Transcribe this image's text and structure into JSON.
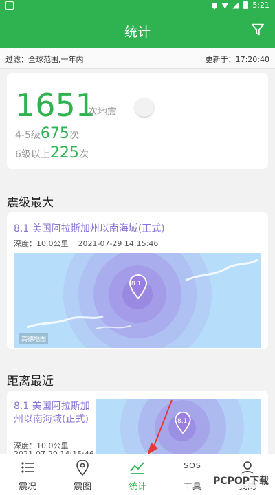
{
  "app": {
    "title": "统计",
    "time": "5:21"
  },
  "filter": {
    "left": "过滤：全球范围,一年内",
    "right": "更新于：17:20:40"
  },
  "stats": {
    "total": "1651",
    "total_unit": "次地震",
    "mag45_prefix": "4-5级",
    "mag45_count": "675",
    "mag45_suffix": "次",
    "mag6_prefix": "6级以上",
    "mag6_count": "225",
    "mag6_suffix": "次"
  },
  "section_max": {
    "title": "震级最大",
    "quake_title": "8.1   美国阿拉斯加州以南海域(正式)",
    "depth": "深度：10.0公里",
    "time": "2021-07-29 14:15:46",
    "marker": "8.1",
    "map_brand": "高德地图"
  },
  "section_near": {
    "title": "距离最近",
    "quake_title": "8.1   美国阿拉斯加州以南海域(正式)",
    "depth": "深度：10.0公里",
    "time": "2021-07-29 14:15:46",
    "marker": "8.1"
  },
  "tabs": [
    {
      "label": "震况"
    },
    {
      "label": "震图"
    },
    {
      "label": "统计"
    },
    {
      "label": "工具",
      "sos": "SOS"
    },
    {
      "label": "我的"
    }
  ],
  "watermark": "PCPOP下载",
  "colors": {
    "primary": "#2fb350",
    "quake_title": "#8a73d6",
    "map_water": "#b6defa",
    "ring": "#9b7fe0"
  }
}
